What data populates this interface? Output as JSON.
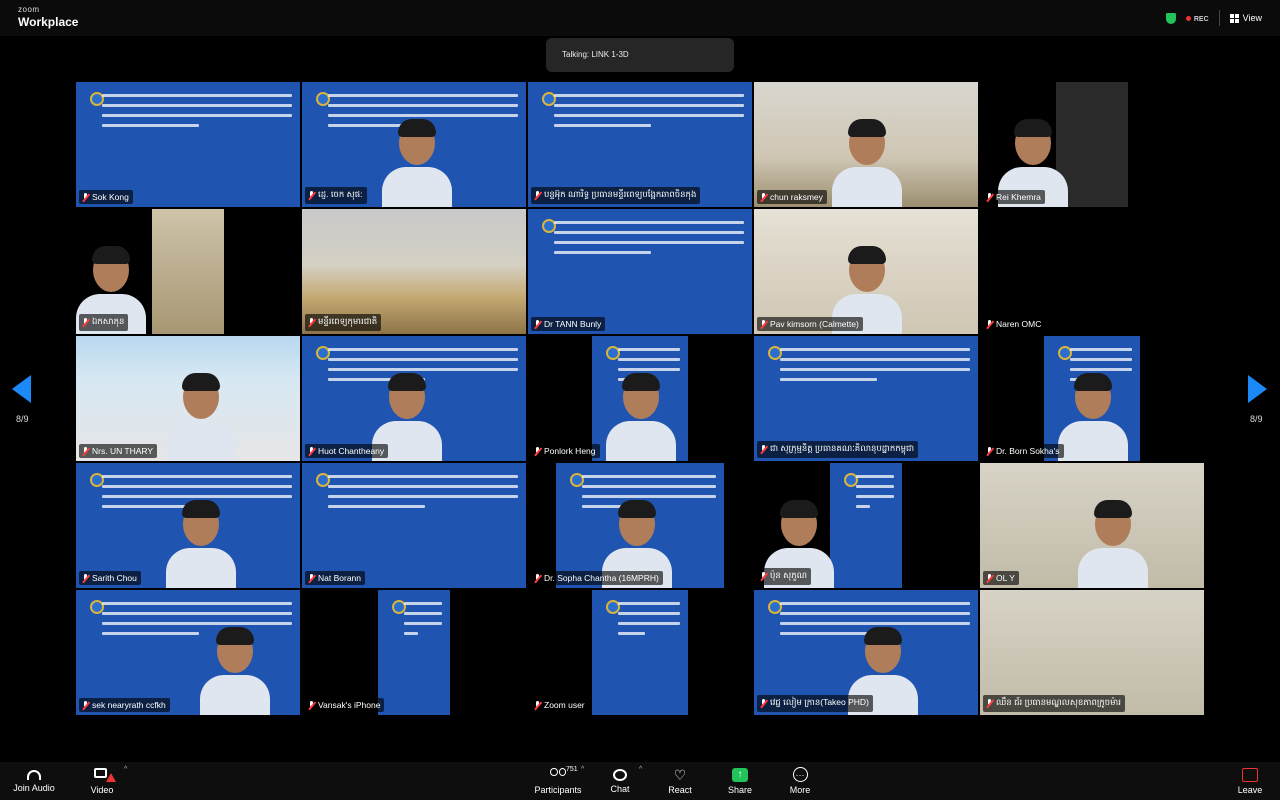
{
  "app": {
    "logo_line1": "zoom",
    "logo_line2": "Workplace"
  },
  "topbar": {
    "rec_label": "REC",
    "view_label": "View"
  },
  "talking": "Talking: LINK 1-3D",
  "pagination": {
    "left": "8/9",
    "right": "8/9"
  },
  "participants": [
    {
      "name": "Sok Kong",
      "muted": true
    },
    {
      "name": "ដេ្ញ. ចេក សុផ:",
      "muted": true
    },
    {
      "name": "បន្ទអ៊ុក ណារិទ្ធ ប្រធានមន្ទីរពេទ្យបង្អែកឆាពចិនកុង",
      "muted": true
    },
    {
      "name": "chun raksmey",
      "muted": true
    },
    {
      "name": "Rei Khemra",
      "muted": true
    },
    {
      "name": "ឯកសាភុន",
      "muted": true
    },
    {
      "name": "មន្ទីរពេទ្យកុមារជាតិ",
      "muted": true
    },
    {
      "name": "Dr TANN Bunly",
      "muted": true
    },
    {
      "name": "Pav kimsorn (Calmette)",
      "muted": true
    },
    {
      "name": "Naren OMC",
      "muted": true
    },
    {
      "name": "Nrs. UN THARY",
      "muted": true
    },
    {
      "name": "Huot Chantheany",
      "muted": true
    },
    {
      "name": "Ponlork Heng",
      "muted": true
    },
    {
      "name": "ជា សុភ្រុម្មនិត្ត ប្រធានគណៈគិលានុបដ្ឋាកកម្ពុជា",
      "muted": true
    },
    {
      "name": "Dr. Born Sokha's",
      "muted": true
    },
    {
      "name": "Sarith Chou",
      "muted": true
    },
    {
      "name": "Nat Borann",
      "muted": true
    },
    {
      "name": "Dr. Sopha Chantha (16MPRH)",
      "muted": true
    },
    {
      "name": "ប៉ុន សុភួណ",
      "muted": true
    },
    {
      "name": "OL Y",
      "muted": true
    },
    {
      "name": "sek nearyrath ccfkh",
      "muted": true
    },
    {
      "name": "Vansak's iPhone",
      "muted": true
    },
    {
      "name": "Zoom user",
      "muted": true
    },
    {
      "name": "វេជ្ជ លៀម ក្រាន(Takeo PHD)",
      "muted": true
    },
    {
      "name": "ឈឹន ជ័រ ប្រធានមណ្ឌលសុខភាពក្រូចម៉ារ",
      "muted": true
    }
  ],
  "toolbar": {
    "join_audio": "Join Audio",
    "video": "Video",
    "participants": "Participants",
    "participants_count": "751",
    "chat": "Chat",
    "react": "React",
    "share": "Share",
    "more": "More",
    "leave": "Leave"
  },
  "colors": {
    "slide_blue": "#1f54b1",
    "accent_blue": "#1b8af7",
    "share_green": "#21c35a",
    "muted_red": "#ff3b3b"
  }
}
